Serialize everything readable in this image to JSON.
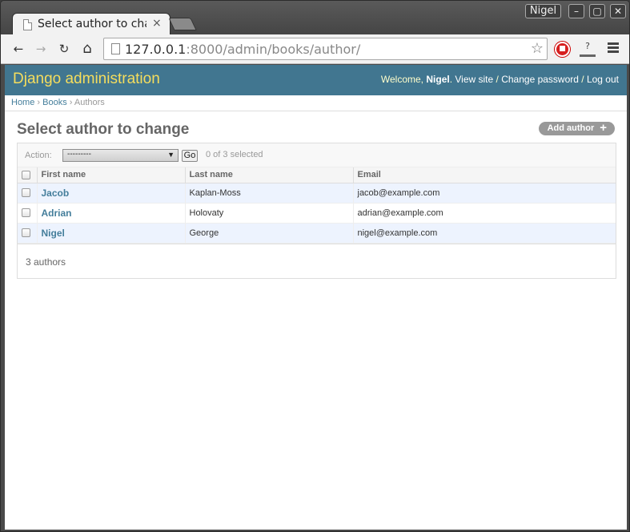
{
  "browser": {
    "tab_title": "Select author to cha",
    "tab_close": "×",
    "profile_name": "Nigel",
    "window_controls": {
      "minimize": "–",
      "maximize": "▢",
      "close": "✕"
    },
    "url_host": "127.0.0.1",
    "url_rest": ":8000/admin/books/author/",
    "nav": {
      "back": "←",
      "forward": "→",
      "reload": "↻",
      "home": "⌂",
      "star": "☆"
    },
    "extensions": {
      "stop": "■",
      "help": "?"
    }
  },
  "header": {
    "branding": "Django administration",
    "welcome": "Welcome,",
    "user": "Nigel",
    "view_site": "View site",
    "change_password": "Change password",
    "log_out": "Log out",
    "sep": " / "
  },
  "breadcrumbs": {
    "home": "Home",
    "books": "Books",
    "authors": "Authors",
    "sep": " › "
  },
  "page": {
    "title": "Select author to change",
    "add_button": "Add author",
    "add_plus": "+"
  },
  "actions": {
    "label": "Action:",
    "selected_value": "---------",
    "go": "Go",
    "selected_count": "0 of 3 selected"
  },
  "table": {
    "headers": [
      "First name",
      "Last name",
      "Email"
    ],
    "rows": [
      {
        "first": "Jacob",
        "last": "Kaplan-Moss",
        "email": "jacob@example.com"
      },
      {
        "first": "Adrian",
        "last": "Holovaty",
        "email": "adrian@example.com"
      },
      {
        "first": "Nigel",
        "last": "George",
        "email": "nigel@example.com"
      }
    ]
  },
  "paginator": {
    "count": "3 authors"
  },
  "colors": {
    "header_bg": "#417690",
    "branding": "#f5dd5d",
    "link": "#447e9b",
    "row_alt": "#edf3fe"
  }
}
